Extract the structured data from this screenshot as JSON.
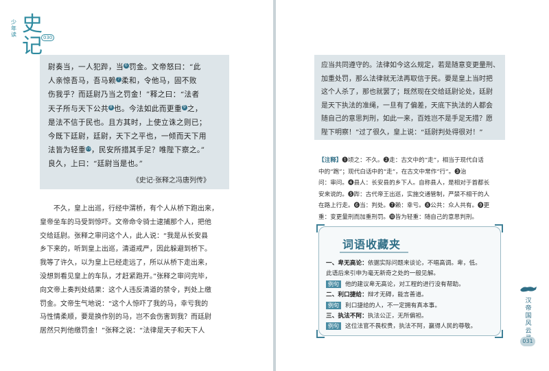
{
  "header": {
    "small": "少年读",
    "big": "史记",
    "num": "030"
  },
  "quote": {
    "lines": [
      [
        "尉奏当，一人犯跸，当",
        "6",
        "罚金。文帝怒曰：“此"
      ],
      [
        "人亲惊吾马，吾马赖",
        "7",
        "柔和，令他马，固不败"
      ],
      [
        "伤我乎？而廷尉乃当之罚金！”释之曰：“法者"
      ],
      [
        "天子所与天下公共",
        "8",
        "也。今法如此而更重",
        "9",
        "之，"
      ],
      [
        "是法不信于民也。且方其时，上使立诛之则已；"
      ],
      [
        "今既下廷尉，廷尉，天下之平也，一倾而天下用"
      ],
      [
        "法皆为轻重",
        "10",
        "，民安所措其手足？唯陛下察之。”"
      ],
      [
        "良久，上曰：“廷尉当是也。”"
      ]
    ],
    "source": "《史记·张释之冯唐列传》"
  },
  "translation": [
    "不久，皇上出巡，行经中渭桥，有个人从桥下跑出来，",
    "皇帝坐车的马受到惊吓。文帝命令骑士逮捕那个人，把他",
    "交给廷尉。张释之审问这个人，此人说：“我是从长安县",
    "乡下来的，听到皇上出巡，清道戒严，因此躲避到桥下。",
    "我等了许久，以为皇上已经走远了，所以从桥下走出来，",
    "没想到看见皇上的车队，才赶紧跑开。”张释之审问完毕，",
    "向文帝上奏判处结果：这个人违反清道的禁令，判处上缴",
    "罚金。文帝生气地说：“这个人惊吓了我的马，幸亏我的",
    "马性情柔顺，要是换作别的马，岂不会伤害到我？而廷尉",
    "居然只判他缴罚金！”张释之说：“法律是天子和天下人"
  ],
  "right_box": [
    "应当共同遵守的。法律如今这么规定，若是随意变更量刑、",
    "加重处罚，那么法律就无法再取信于民。要是皇上当时把",
    "这个人杀了，那也就罢了；既然现在交给廷尉论处，廷尉",
    "是天下执法的准绳，一旦有了偏差，天底下执法的人都会",
    "随自己的意思判刑，如此一来，百姓岂不是手足无措？愿",
    "陛下明察！”过了很久，皇上说：“廷尉判处得很对！”"
  ],
  "notes": {
    "tag": "【注释】",
    "lines": [
      "❶顷之：不久。❷走：古文中的“走”，相当于现代白话",
      "中的“跑”；现代白话中的“走”，在古文中常作“行”。❸治",
      "问：审问。❹县人：长安县的乡下人。自称县人，是相对于首都长",
      "安来说的。❺跸：古代帝王出巡，实施交通管制，严禁不相干的人",
      "在路上行走。❻当：判处。❼赖：幸亏。❽公共：众人共有。❾更",
      "重：变更量刑而加重刑罚。❿皆为轻重：随自己的意思判刑。"
    ]
  },
  "vocab": {
    "title": "词语收藏夹",
    "example_label": "例句",
    "items": [
      {
        "term": "一、卑无高论：",
        "def1": "依据实际问题来谈论，不唱高调。卑，低。",
        "def2": "此语后来引申为毫无新奇之处的一般见解。",
        "ex": "他的建议卑无高论，对工程的进行没有帮助。"
      },
      {
        "term": "二、利口捷给：",
        "def1": "辩才无碍，能言善道。",
        "def2": "",
        "ex": "利口捷给的人，不一定拥有真本事。"
      },
      {
        "term": "三、执法不阿：",
        "def1": "执法公正，无所偏袒。",
        "def2": "",
        "ex": "这位法官不畏权贵，执法不阿，赢得人民的尊敬。"
      }
    ]
  },
  "side_title": "汉帝国风云录",
  "page_number": "031",
  "colors": {
    "accent": "#2f6e86",
    "box": "#dde5e9"
  }
}
